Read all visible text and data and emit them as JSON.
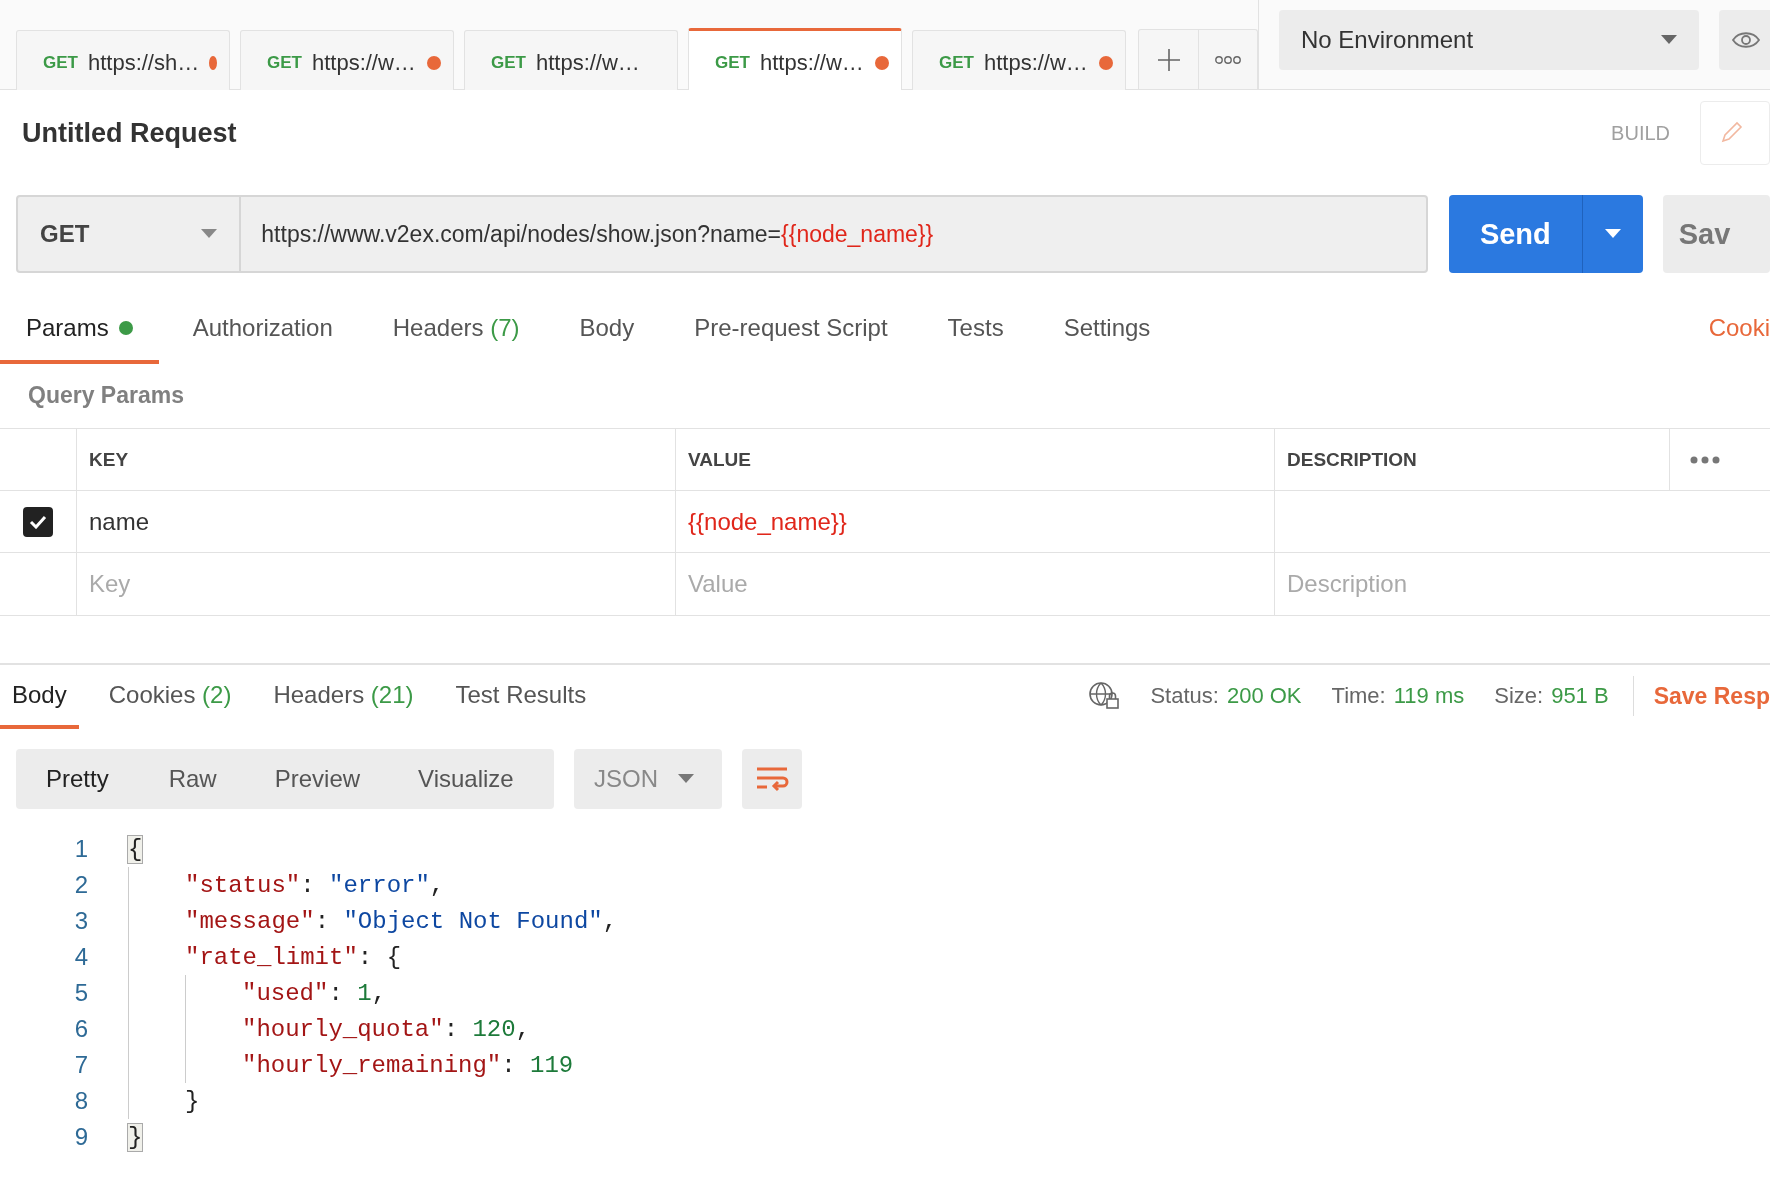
{
  "request_tabs": [
    {
      "method": "GET",
      "url": "https://sh…",
      "unsaved": true,
      "selected": false
    },
    {
      "method": "GET",
      "url": "https://w…",
      "unsaved": true,
      "selected": false
    },
    {
      "method": "GET",
      "url": "https://w…",
      "unsaved": false,
      "selected": false
    },
    {
      "method": "GET",
      "url": "https://w…",
      "unsaved": true,
      "selected": true
    },
    {
      "method": "GET",
      "url": "https://w…",
      "unsaved": true,
      "selected": false
    }
  ],
  "environment": {
    "value": "No Environment"
  },
  "request": {
    "title": "Untitled Request",
    "mode": "BUILD",
    "method": "GET",
    "url": "https://www.v2ex.com/api/nodes/show.json?name=",
    "url_variable": "{{node_name}}",
    "send": "Send",
    "save": "Sav"
  },
  "section_tabs": [
    {
      "label": "Params",
      "indicator": true,
      "selected": true
    },
    {
      "label": "Authorization",
      "indicator": false,
      "selected": false
    },
    {
      "label": "Headers",
      "count": "(7)",
      "indicator": false,
      "selected": false
    },
    {
      "label": "Body",
      "indicator": false,
      "selected": false
    },
    {
      "label": "Pre-request Script",
      "indicator": false,
      "selected": false
    },
    {
      "label": "Tests",
      "indicator": false,
      "selected": false
    },
    {
      "label": "Settings",
      "indicator": false,
      "selected": false
    }
  ],
  "cookies_link": "Cooki",
  "query_params": {
    "title": "Query Params",
    "columns": [
      "KEY",
      "VALUE",
      "DESCRIPTION"
    ],
    "rows": [
      {
        "checked": true,
        "key": "name",
        "value": "{{node_name}}"
      }
    ],
    "empty_row": {
      "key": {
        "placeholder": "Key"
      },
      "value": {
        "placeholder": "Value"
      },
      "description": {
        "placeholder": "Description"
      }
    }
  },
  "response": {
    "tabs": [
      {
        "label": "Body",
        "selected": true
      },
      {
        "label": "Cookies",
        "count": "(2)",
        "selected": false
      },
      {
        "label": "Headers",
        "count": "(21)",
        "selected": false
      },
      {
        "label": "Test Results",
        "selected": false
      }
    ],
    "stats": [
      {
        "label": "Status:",
        "value": "200 OK"
      },
      {
        "label": "Time:",
        "value": "119 ms"
      },
      {
        "label": "Size:",
        "value": "951 B"
      }
    ],
    "save_link": "Save Resp",
    "views": [
      {
        "label": "Pretty",
        "selected": true
      },
      {
        "label": "Raw",
        "selected": false
      },
      {
        "label": "Preview",
        "selected": false
      },
      {
        "label": "Visualize",
        "selected": false
      }
    ],
    "format": "JSON",
    "code": [
      {
        "number": "1",
        "tokens": [
          {
            "kind": "bracket",
            "text": "{"
          }
        ],
        "children": [
          {
            "number": "2",
            "tokens": [
              {
                "kind": "key",
                "text": "\"status\""
              },
              {
                "kind": "punct",
                "text": ": "
              },
              {
                "kind": "string",
                "text": "\"error\""
              },
              {
                "kind": "punct",
                "text": ","
              }
            ]
          },
          {
            "number": "3",
            "tokens": [
              {
                "kind": "key",
                "text": "\"message\""
              },
              {
                "kind": "punct",
                "text": ": "
              },
              {
                "kind": "string",
                "text": "\"Object Not Found\""
              },
              {
                "kind": "punct",
                "text": ","
              }
            ]
          },
          {
            "number": "4",
            "tokens": [
              {
                "kind": "key",
                "text": "\"rate_limit\""
              },
              {
                "kind": "punct",
                "text": ": {"
              }
            ],
            "children": [
              {
                "number": "5",
                "tokens": [
                  {
                    "kind": "key",
                    "text": "\"used\""
                  },
                  {
                    "kind": "punct",
                    "text": ": "
                  },
                  {
                    "kind": "number",
                    "text": "1"
                  },
                  {
                    "kind": "punct",
                    "text": ","
                  }
                ]
              },
              {
                "number": "6",
                "tokens": [
                  {
                    "kind": "key",
                    "text": "\"hourly_quota\""
                  },
                  {
                    "kind": "punct",
                    "text": ": "
                  },
                  {
                    "kind": "number",
                    "text": "120"
                  },
                  {
                    "kind": "punct",
                    "text": ","
                  }
                ]
              },
              {
                "number": "7",
                "tokens": [
                  {
                    "kind": "key",
                    "text": "\"hourly_remaining\""
                  },
                  {
                    "kind": "punct",
                    "text": ": "
                  },
                  {
                    "kind": "number",
                    "text": "119"
                  }
                ]
              }
            ]
          },
          {
            "number": "8",
            "tokens": [
              {
                "kind": "punct",
                "text": "}"
              }
            ]
          }
        ]
      },
      {
        "number": "9",
        "tokens": [
          {
            "kind": "bracket",
            "text": "}"
          }
        ]
      }
    ]
  }
}
